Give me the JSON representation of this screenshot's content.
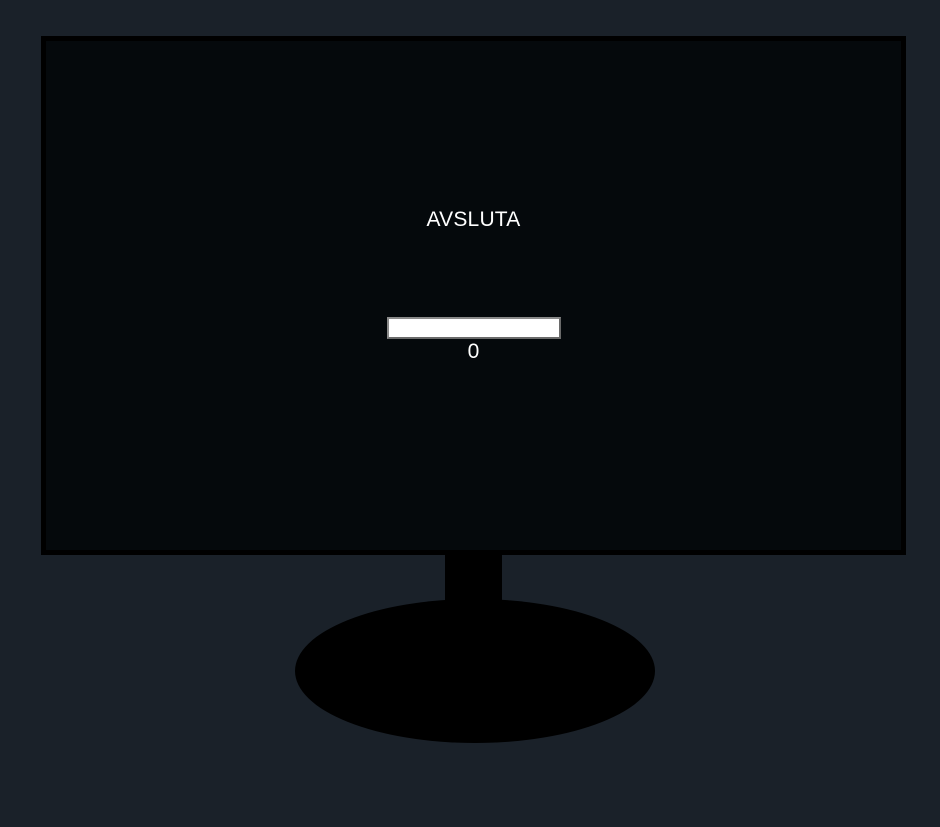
{
  "screen": {
    "title": "AVSLUTA",
    "progress": {
      "value_label": "0",
      "fraction": 0
    }
  },
  "colors": {
    "background": "#1a2129",
    "screen": "#05090c",
    "bezel": "#000000",
    "text": "#ffffff",
    "progress_track": "#ffffff"
  }
}
